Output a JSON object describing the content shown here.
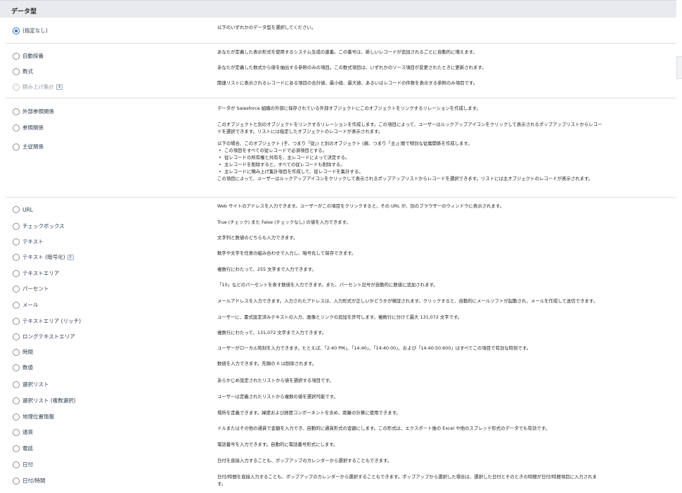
{
  "header": {
    "title": "データ型"
  },
  "groups": [
    {
      "items": [
        {
          "label": "(指定なし)",
          "description": "以下のいずれかのデータ型を選択してください。",
          "checked": true
        }
      ]
    },
    {
      "items": [
        {
          "label": "自動採番",
          "description": "あなたが定義した表示形式を使用するシステム生成の連番。この番号は、新しいレコードが追加されるごとに自動的に増えます。"
        },
        {
          "label": "数式",
          "description": "あなたが定義した数式から値を抽出する参照のみの項目。この数式項目は、いずれかのソース項目が変更されたときに更新されます。"
        },
        {
          "label": "積み上げ集計",
          "description": "関連リストに表示されるレコードにある項目の合計値、最小値、最大値、あるいはレコードの件数を表示する参照のみ項目です。",
          "disabled": true,
          "info": "i"
        }
      ]
    },
    {
      "items": [
        {
          "label": "外部参照関係",
          "description": "データが Salesforce 組織の外部に保存されている外部オブジェクトにこのオブジェクトをリンクするリレーションを作成します。"
        },
        {
          "label": "参照関係",
          "description_lines": [
            "このオブジェクトと別のオブジェクトをリンクするリレーションを作成します。この項目によって、ユーザーはルックアップアイコンをクリックして表示されるポップアップリストからレコー",
            "ドを選択できます。リストには指定したオブジェクトのレコードが表示されます。"
          ]
        },
        {
          "label": "主従関係",
          "description_intro": "以下の場合、このオブジェクト (子、つまり「従」) と別のオブジェクト (親、つまり「主」) 間で特別な従属関係を作成します。",
          "bullets": [
            "この項目をすべての従レコードで必須項目とする。",
            "従レコードの所有権と共有を、主レコードによって決定する。",
            "主レコードを削除すると、すべての従レコードも削除する。",
            "主レコードに積み上げ集計項目を作成して、従レコードを集計する。"
          ],
          "description_outro": "この項目によって、ユーザーはルックアップアイコンをクリックして表示されるポップアップリストからレコードを選択できます。リストには主オブジェクトのレコードが表示されます。"
        }
      ]
    },
    {
      "items": [
        {
          "label": "URL",
          "description": "Web サイトのアドレスを入力できます。ユーザーがこの項目をクリックすると、その URL が、別のブラウザーのウィンドウに表示されます。"
        },
        {
          "label": "チェックボックス",
          "description": "True (チェック) また False (チェックなし) の値を入力できます。"
        },
        {
          "label": "テキスト",
          "description": "文字列と数値のどちらも入力できます。"
        },
        {
          "label": "テキスト (暗号化)",
          "description": "数字や文字を任意の組み合わせで入力し、暗号化して保存できます。",
          "info": "i"
        },
        {
          "label": "テキストエリア",
          "description": "複数行にわたって、255 文字まで入力できます。"
        },
        {
          "label": "パーセント",
          "description": "「10」などのパーセントを表す数値を入力できます。また、パーセント記号が自動的に数値に追加されます。"
        },
        {
          "label": "メール",
          "description": "メールアドレスを入力できます。入力されたアドレスは、入力形式が正しいかどうかが検証されます。クリックすると、自動的にメールソフトが起動され、メールを作成して送信できます。"
        },
        {
          "label": "テキストエリア (リッチ)",
          "description": "ユーザーに、書式設定済みテキストの入力、画像とリンクの追加を許可します。複数行に分けて最大 131,072 文字です。"
        },
        {
          "label": "ロングテキストエリア",
          "description": "複数行にわたって、131,072 文字まで入力できます。"
        },
        {
          "label": "時間",
          "description": "ユーザーがローカル時刻を入力できます。たとえば、「2:40 PM」、「14:40」、「14:40:00」、および「14:40:50.600」はすべてこの項目で有効な時刻です。"
        },
        {
          "label": "数値",
          "description": "数値を入力できます。先頭の 0 は削除されます。"
        },
        {
          "label": "選択リスト",
          "description": "あらかじめ設定されたリストから値を選択する項目です。"
        },
        {
          "label": "選択リスト (複数選択)",
          "description": "ユーザーは定義されたリストから複数の値を選択可能です。"
        },
        {
          "label": "地理位置情報",
          "description": "場所を定義できます。緯度および経度コンポーネントを含め、距離の計算に使用できます。"
        },
        {
          "label": "通貨",
          "description": "ドルまたはその他の通貨で金額を入力でき、自動的に通貨形式の金額にします。この形式は、エクスポート後の Excel や他のスプレッド形式のデータでも有効です。"
        },
        {
          "label": "電話",
          "description": "電話番号を入力できます。自動的に電話番号形式にします。"
        },
        {
          "label": "日付",
          "description": "日付を直接入力することも、ポップアップのカレンダーから選択することもできます。"
        },
        {
          "label": "日付/時間",
          "description_lines": [
            "日付/時間を直接入力することも、ポップアップのカレンダーから選択することもできます。ポップアップから選択した場合は、選択した日付とそのときの時間が日付/時間項目に入力されま",
            "す。"
          ]
        }
      ]
    }
  ]
}
